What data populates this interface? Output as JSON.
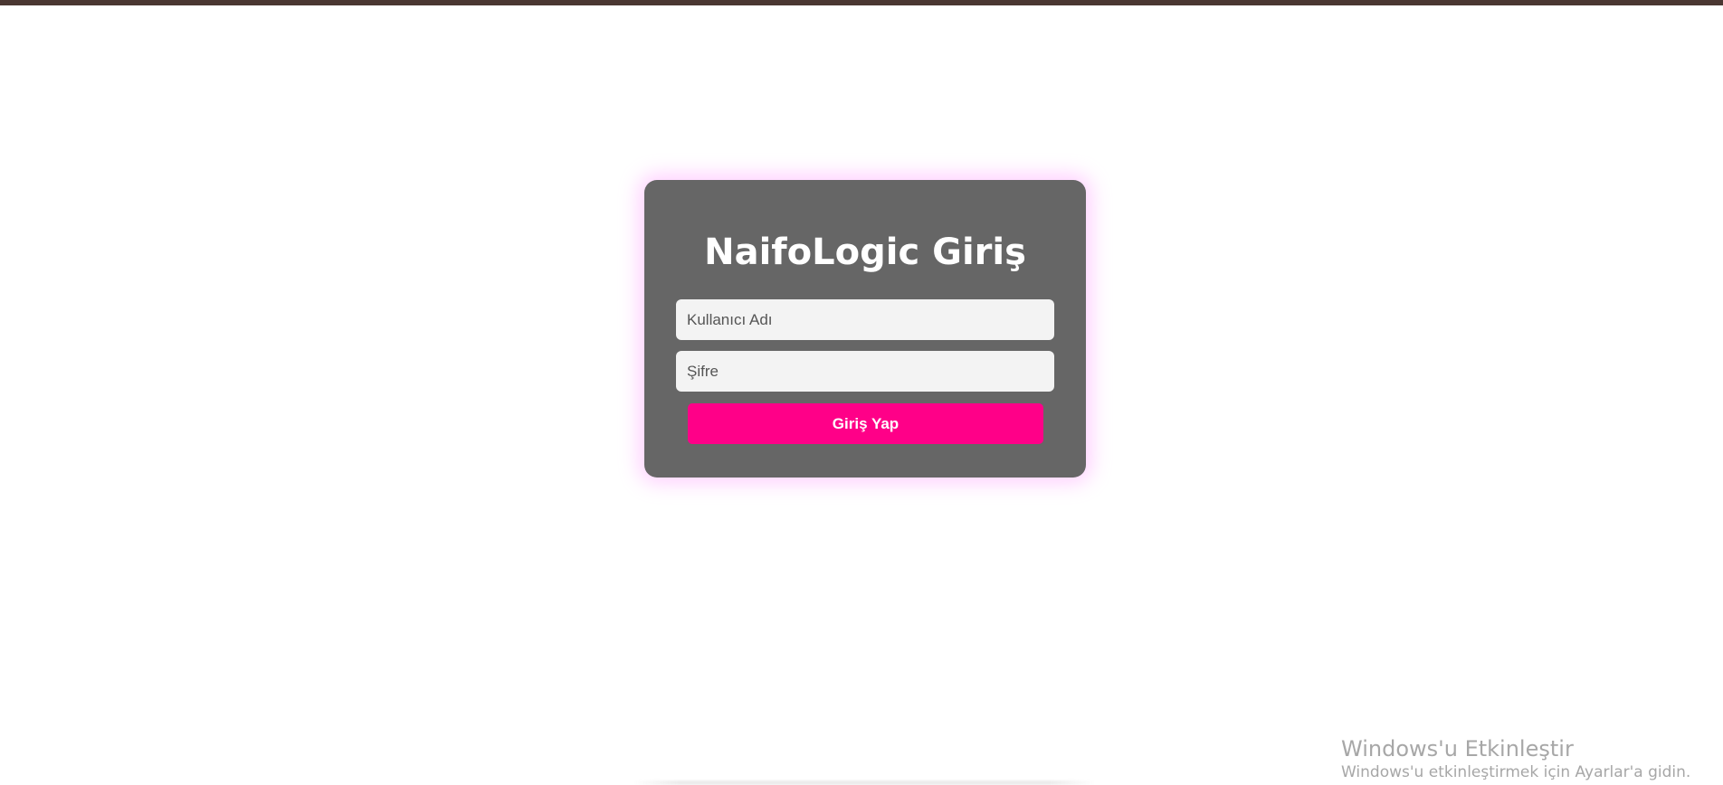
{
  "colors": {
    "top_bar": "#4a3732",
    "card_background": "#666666",
    "card_glow": "#ff96ff",
    "input_background": "#f3f3f3",
    "button_background": "#ff0088",
    "button_text": "#ffffff",
    "watermark_text": "#a7a7a7"
  },
  "login": {
    "title": "NaifoLogic Giriş",
    "username_placeholder": "Kullanıcı Adı",
    "username_value": "",
    "password_placeholder": "Şifre",
    "password_value": "",
    "submit_label": "Giriş Yap"
  },
  "windows_activation": {
    "title": "Windows'u Etkinleştir",
    "subtitle": "Windows'u etkinleştirmek için Ayarlar'a gidin."
  }
}
